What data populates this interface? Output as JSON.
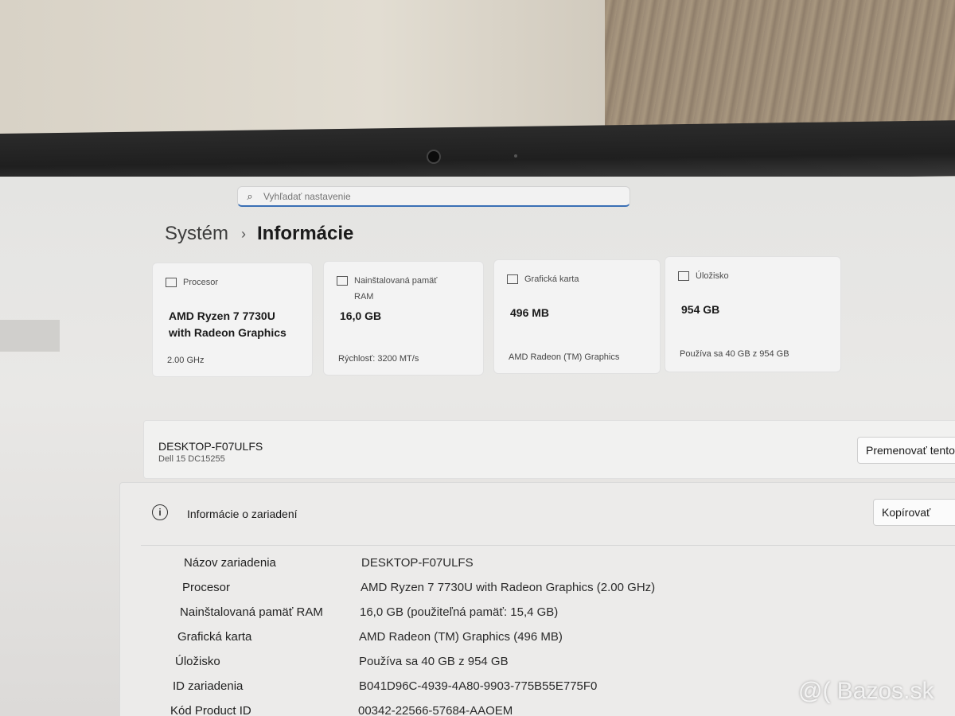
{
  "search": {
    "placeholder": "Vyhľadať nastavenie"
  },
  "breadcrumb": {
    "parent": "Systém",
    "separator": "›",
    "current": "Informácie"
  },
  "cards": [
    {
      "label": "Procesor",
      "value_line1": "AMD Ryzen 7 7730U",
      "value_line2": "with Radeon Graphics",
      "sub": "2.00 GHz"
    },
    {
      "label_line1": "Nainštalovaná pamäť",
      "label_line2": "RAM",
      "value": "16,0 GB",
      "sub": "Rýchlosť: 3200 MT/s"
    },
    {
      "label": "Grafická karta",
      "value": "496 MB",
      "sub": "AMD Radeon (TM) Graphics"
    },
    {
      "label": "Úložisko",
      "value": "954 GB",
      "sub": "Používa sa 40 GB z 954 GB"
    }
  ],
  "device": {
    "name": "DESKTOP-F07ULFS",
    "model": "Dell 15 DC15255",
    "rename_button": "Premenovať tento počítač"
  },
  "device_info": {
    "title": "Informácie o zariadení",
    "copy_button": "Kopírovať",
    "rows": [
      {
        "key": "Názov zariadenia",
        "value": "DESKTOP-F07ULFS"
      },
      {
        "key": "Procesor",
        "value": "AMD Ryzen 7 7730U with Radeon Graphics (2.00 GHz)"
      },
      {
        "key": "Nainštalovaná pamäť RAM",
        "value": "16,0 GB (použiteľná pamäť: 15,4 GB)"
      },
      {
        "key": "Grafická karta",
        "value": "AMD Radeon (TM) Graphics (496 MB)"
      },
      {
        "key": "Úložisko",
        "value": "Používa sa 40 GB z 954 GB"
      },
      {
        "key": "ID zariadenia",
        "value": "B041D96C-4939-4A80-9903-775B55E775F0"
      },
      {
        "key": "Kód Product ID",
        "value": "00342-22566-57684-AAOEM"
      }
    ]
  },
  "watermark": "@( Bazos.sk"
}
